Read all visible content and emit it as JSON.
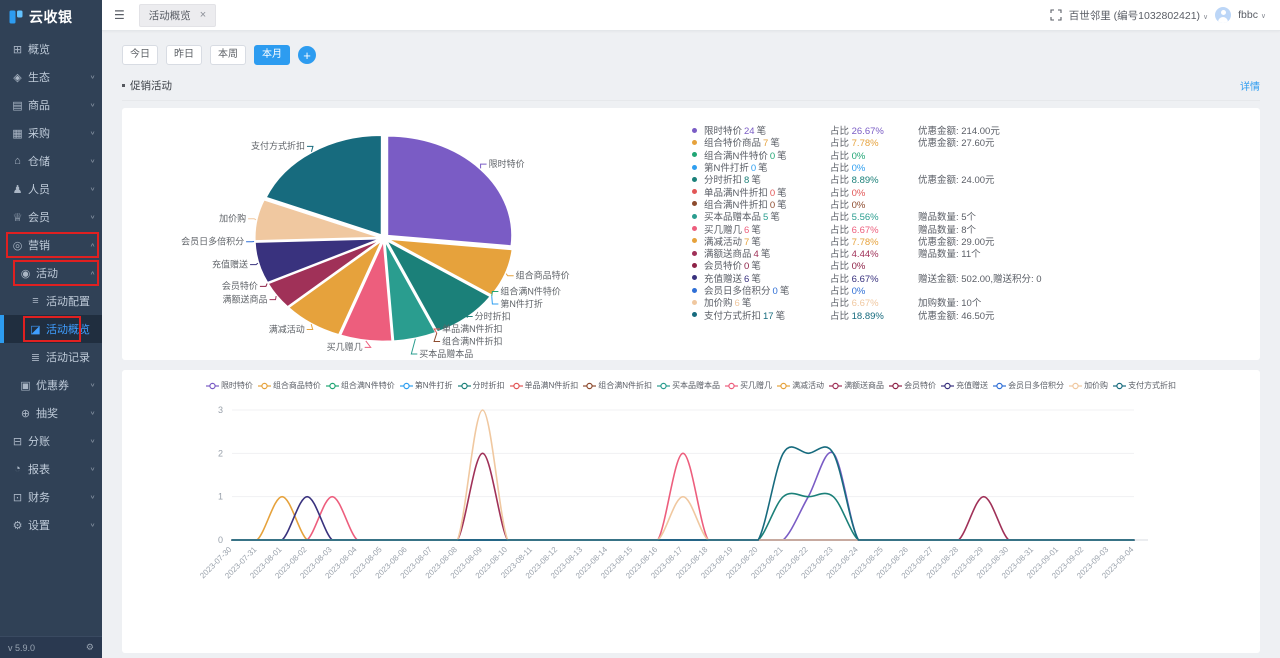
{
  "app": {
    "name": "云收银",
    "version": "v 5.9.0"
  },
  "icons": {
    "collapse": "☰",
    "close": "×",
    "plus": "+",
    "gear": "⚙",
    "chevron_down": "∨",
    "chevron_up": "∧",
    "caret_down": "∨",
    "fullscreen": "fullscreen-arrows"
  },
  "sidebar": {
    "items": [
      {
        "id": "overview",
        "label": "概览",
        "glyph": "⊞",
        "level": 1
      },
      {
        "id": "ecosystem",
        "label": "生态",
        "glyph": "◈",
        "level": 1,
        "chevron": "down"
      },
      {
        "id": "goods",
        "label": "商品",
        "glyph": "▤",
        "level": 1,
        "chevron": "down"
      },
      {
        "id": "purchase",
        "label": "采购",
        "glyph": "▦",
        "level": 1,
        "chevron": "down"
      },
      {
        "id": "warehouse",
        "label": "仓储",
        "glyph": "⌂",
        "level": 1,
        "chevron": "down"
      },
      {
        "id": "staff",
        "label": "人员",
        "glyph": "♟",
        "level": 1,
        "chevron": "down"
      },
      {
        "id": "member",
        "label": "会员",
        "glyph": "♕",
        "level": 1,
        "chevron": "down"
      },
      {
        "id": "marketing",
        "label": "营销",
        "glyph": "◎",
        "level": 1,
        "chevron": "up",
        "highlight": true
      },
      {
        "id": "activity",
        "label": "活动",
        "glyph": "◉",
        "level": 2,
        "chevron": "up",
        "highlight": true
      },
      {
        "id": "activity-config",
        "label": "活动配置",
        "glyph": "≡",
        "level": 3
      },
      {
        "id": "activity-overview",
        "label": "活动概览",
        "glyph": "◪",
        "level": 3,
        "active": true,
        "highlight": true
      },
      {
        "id": "activity-record",
        "label": "活动记录",
        "glyph": "≣",
        "level": 3
      },
      {
        "id": "coupon",
        "label": "优惠券",
        "glyph": "▣",
        "level": 2,
        "chevron": "down"
      },
      {
        "id": "lottery",
        "label": "抽奖",
        "glyph": "⊕",
        "level": 2,
        "chevron": "down"
      },
      {
        "id": "split-account",
        "label": "分账",
        "glyph": "⊟",
        "level": 1,
        "chevron": "down"
      },
      {
        "id": "report",
        "label": "报表",
        "glyph": "◔",
        "level": 1,
        "chevron": "down"
      },
      {
        "id": "finance",
        "label": "财务",
        "glyph": "⊡",
        "level": 1,
        "chevron": "down"
      },
      {
        "id": "settings",
        "label": "设置",
        "glyph": "⚙",
        "level": 1,
        "chevron": "down"
      }
    ]
  },
  "topbar": {
    "tab": "活动概览",
    "store": "百世邻里 (编号1032802421)",
    "user": "fbbc"
  },
  "filters": {
    "options": [
      "今日",
      "昨日",
      "本周",
      "本月"
    ],
    "active_index": 3
  },
  "section": {
    "title": "促销活动",
    "detail_link": "详情"
  },
  "stats": {
    "unit": "笔",
    "share_label": "占比",
    "rows": [
      {
        "name": "限时特价",
        "count": 24,
        "share": "26.67%",
        "extra": "优惠金额: 214.00元",
        "color": "#7a5cc5"
      },
      {
        "name": "组合特价商品",
        "count": 7,
        "share": "7.78%",
        "extra": "优惠金额: 27.60元",
        "color": "#e6a23c"
      },
      {
        "name": "组合满N件特价",
        "count": 0,
        "share": "0%",
        "extra": "",
        "color": "#21a675"
      },
      {
        "name": "第N件打折",
        "count": 0,
        "share": "0%",
        "extra": "",
        "color": "#2f9ff0"
      },
      {
        "name": "分时折扣",
        "count": 8,
        "share": "8.89%",
        "extra": "优惠金额: 24.00元",
        "color": "#1b8079"
      },
      {
        "name": "单品满N件折扣",
        "count": 0,
        "share": "0%",
        "extra": "",
        "color": "#e25656"
      },
      {
        "name": "组合满N件折扣",
        "count": 0,
        "share": "0%",
        "extra": "",
        "color": "#8d4b2e"
      },
      {
        "name": "买本品赠本品",
        "count": 5,
        "share": "5.56%",
        "extra": "赠品数量: 5个",
        "color": "#2a9d8f"
      },
      {
        "name": "买几赠几",
        "count": 6,
        "share": "6.67%",
        "extra": "赠品数量: 8个",
        "color": "#ed5e7d"
      },
      {
        "name": "满减活动",
        "count": 7,
        "share": "7.78%",
        "extra": "优惠金额: 29.00元",
        "color": "#e6a23c"
      },
      {
        "name": "满额送商品",
        "count": 4,
        "share": "4.44%",
        "extra": "赠品数量: 11个",
        "color": "#a03158"
      },
      {
        "name": "会员特价",
        "count": 0,
        "share": "0%",
        "extra": "",
        "color": "#8e2247"
      },
      {
        "name": "充值赠送",
        "count": 6,
        "share": "6.67%",
        "extra": "赠送金额: 502.00,赠送积分: 0",
        "color": "#39327e"
      },
      {
        "name": "会员日多倍积分",
        "count": 0,
        "share": "0%",
        "extra": "",
        "color": "#2f6fd6"
      },
      {
        "name": "加价购",
        "count": 6,
        "share": "6.67%",
        "extra": "加购数量: 10个",
        "color": "#f0c8a0"
      },
      {
        "name": "支付方式折扣",
        "count": 17,
        "share": "18.89%",
        "extra": "优惠金额: 46.50元",
        "color": "#176b7e"
      }
    ]
  },
  "chart_data": [
    {
      "type": "pie",
      "items": [
        {
          "name": "限时特价",
          "value": 24,
          "percent": 26.67,
          "color": "#7a5cc5"
        },
        {
          "name": "组合商品特价",
          "value": 7,
          "percent": 7.78,
          "color": "#e6a23c"
        },
        {
          "name": "组合满N件特价",
          "value": 0,
          "percent": 0,
          "color": "#21a675"
        },
        {
          "name": "第N件打折",
          "value": 0,
          "percent": 0,
          "color": "#2f9ff0"
        },
        {
          "name": "分时折扣",
          "value": 8,
          "percent": 8.89,
          "color": "#1b8079"
        },
        {
          "name": "单品满N件折扣",
          "value": 0,
          "percent": 0,
          "color": "#e25656"
        },
        {
          "name": "组合满N件折扣",
          "value": 0,
          "percent": 0,
          "color": "#8d4b2e"
        },
        {
          "name": "买本品赠本品",
          "value": 5,
          "percent": 5.56,
          "color": "#2a9d8f"
        },
        {
          "name": "买几赠几",
          "value": 6,
          "percent": 6.67,
          "color": "#ed5e7d"
        },
        {
          "name": "满减活动",
          "value": 7,
          "percent": 7.78,
          "color": "#e6a23c"
        },
        {
          "name": "满额送商品",
          "value": 4,
          "percent": 4.44,
          "color": "#a03158"
        },
        {
          "name": "会员特价",
          "value": 0,
          "percent": 0,
          "color": "#8e2247"
        },
        {
          "name": "充值赠送",
          "value": 6,
          "percent": 6.67,
          "color": "#39327e"
        },
        {
          "name": "会员日多倍积分",
          "value": 0,
          "percent": 0,
          "color": "#2f6fd6"
        },
        {
          "name": "加价购",
          "value": 6,
          "percent": 6.67,
          "color": "#f0c8a0"
        },
        {
          "name": "支付方式折扣",
          "value": 17,
          "percent": 18.89,
          "color": "#176b7e"
        }
      ]
    },
    {
      "type": "line",
      "ylim": [
        0,
        3
      ],
      "yticks": [
        0,
        1,
        2,
        3
      ],
      "x": [
        "2023-07-30",
        "2023-07-31",
        "2023-08-01",
        "2023-08-02",
        "2023-08-03",
        "2023-08-04",
        "2023-08-05",
        "2023-08-06",
        "2023-08-07",
        "2023-08-08",
        "2023-08-09",
        "2023-08-10",
        "2023-08-11",
        "2023-08-12",
        "2023-08-13",
        "2023-08-14",
        "2023-08-15",
        "2023-08-16",
        "2023-08-17",
        "2023-08-18",
        "2023-08-19",
        "2023-08-20",
        "2023-08-21",
        "2023-08-22",
        "2023-08-23",
        "2023-08-24",
        "2023-08-25",
        "2023-08-26",
        "2023-08-27",
        "2023-08-28",
        "2023-08-29",
        "2023-08-30",
        "2023-08-31",
        "2023-09-01",
        "2023-09-02",
        "2023-09-03",
        "2023-09-04"
      ],
      "series": [
        {
          "name": "限时特价",
          "color": "#7a5cc5",
          "points": {
            "2023-08-22": 1,
            "2023-08-23": 2
          }
        },
        {
          "name": "组合商品特价",
          "color": "#e6a23c",
          "points": {}
        },
        {
          "name": "组合满N件特价",
          "color": "#21a675",
          "points": {}
        },
        {
          "name": "第N件打折",
          "color": "#2f9ff0",
          "points": {}
        },
        {
          "name": "分时折扣",
          "color": "#1b8079",
          "points": {
            "2023-08-21": 1,
            "2023-08-22": 1,
            "2023-08-23": 1
          }
        },
        {
          "name": "单品满N件折扣",
          "color": "#e25656",
          "points": {}
        },
        {
          "name": "组合满N件折扣",
          "color": "#8d4b2e",
          "points": {}
        },
        {
          "name": "买本品赠本品",
          "color": "#2a9d8f",
          "points": {}
        },
        {
          "name": "买几赠几",
          "color": "#ed5e7d",
          "points": {
            "2023-08-03": 1,
            "2023-08-17": 2
          }
        },
        {
          "name": "满减活动",
          "color": "#e6a23c",
          "points": {
            "2023-08-01": 1
          }
        },
        {
          "name": "满额送商品",
          "color": "#a03158",
          "points": {
            "2023-08-09": 2,
            "2023-08-29": 1
          }
        },
        {
          "name": "会员特价",
          "color": "#8e2247",
          "points": {}
        },
        {
          "name": "充值赠送",
          "color": "#39327e",
          "points": {
            "2023-08-02": 1
          }
        },
        {
          "name": "会员日多倍积分",
          "color": "#2f6fd6",
          "points": {}
        },
        {
          "name": "加价购",
          "color": "#f0c8a0",
          "points": {
            "2023-08-09": 3,
            "2023-08-17": 1
          }
        },
        {
          "name": "支付方式折扣",
          "color": "#176b7e",
          "points": {
            "2023-08-21": 2,
            "2023-08-22": 2,
            "2023-08-23": 2
          }
        }
      ]
    }
  ]
}
